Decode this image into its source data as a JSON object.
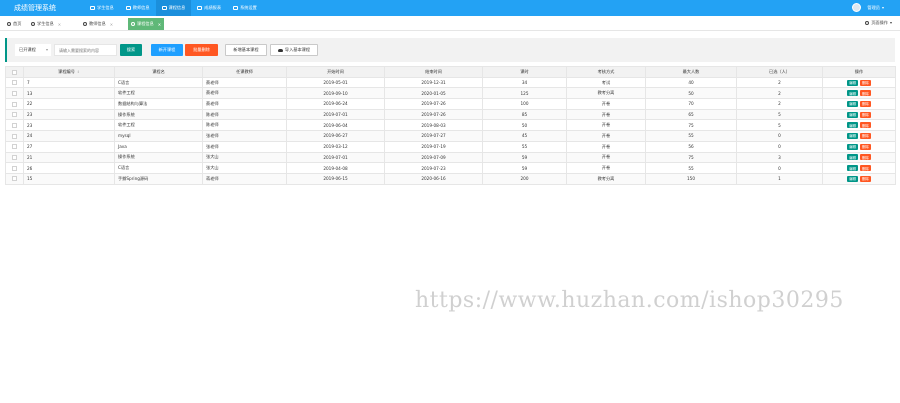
{
  "app": {
    "title": "成绩管理系统",
    "user_name": "管理员"
  },
  "nav": [
    {
      "label": "学生信息"
    },
    {
      "label": "教师信息"
    },
    {
      "label": "课程信息"
    },
    {
      "label": "成绩报表"
    },
    {
      "label": "系统设置"
    }
  ],
  "tabs": [
    {
      "label": "首页"
    },
    {
      "label": "学生信息"
    },
    {
      "label": "教师信息"
    },
    {
      "label": "课程信息"
    }
  ],
  "page_ops_label": "页面操作",
  "toolbar": {
    "select_value": "已开课程",
    "search_placeholder": "请输入需要搜索的内容",
    "search_label": "搜索",
    "open_label": "新开课程",
    "batch_delete_label": "批量删除",
    "add_basic_label": "新增基本课程",
    "import_label": "导入基本课程"
  },
  "table": {
    "headers": [
      "课程编号",
      "课程名",
      "任课教师",
      "开始时间",
      "结束时间",
      "课时",
      "考核方式",
      "最大人数",
      "已选（人）",
      "操作"
    ],
    "edit_label": "编辑",
    "delete_label": "删除",
    "rows": [
      [
        "7",
        "C语言",
        "蔡老师",
        "2019-05-01",
        "2019-12-31",
        "34",
        "考试",
        "40",
        "2"
      ],
      [
        "13",
        "软件工程",
        "蔡老师",
        "2019-09-10",
        "2020-01-05",
        "125",
        "教考分离",
        "50",
        "2"
      ],
      [
        "22",
        "数据结构与算法",
        "蔡老师",
        "2019-06-24",
        "2019-07-26",
        "100",
        "开卷",
        "70",
        "2"
      ],
      [
        "23",
        "操作系统",
        "陈老师",
        "2019-07-01",
        "2019-07-26",
        "85",
        "开卷",
        "65",
        "5"
      ],
      [
        "23",
        "软件工程",
        "陈老师",
        "2019-06-04",
        "2019-08-03",
        "50",
        "开卷",
        "75",
        "5"
      ],
      [
        "24",
        "mysql",
        "张老师",
        "2019-06-27",
        "2019-07-27",
        "45",
        "开卷",
        "55",
        "0"
      ],
      [
        "27",
        "Java",
        "张老师",
        "2019-03-12",
        "2019-07-19",
        "55",
        "开卷",
        "56",
        "0"
      ],
      [
        "21",
        "操作系统",
        "张大山",
        "2019-07-01",
        "2019-07-09",
        "59",
        "开卷",
        "75",
        "3"
      ],
      [
        "26",
        "C语言",
        "张大山",
        "2019-04-08",
        "2019-07-23",
        "59",
        "开卷",
        "55",
        "0"
      ],
      [
        "15",
        "手撕Spring源码",
        "蒋老师",
        "2019-06-15",
        "2020-06-16",
        "200",
        "教考分离",
        "150",
        "1"
      ]
    ]
  },
  "watermark": "https://www.huzhan.com/ishop30295",
  "colors": {
    "topbar": "#23a2f4",
    "active_tab": "#5fb878",
    "primary": "#009688",
    "blue": "#1e9fff",
    "danger": "#ff5722"
  }
}
